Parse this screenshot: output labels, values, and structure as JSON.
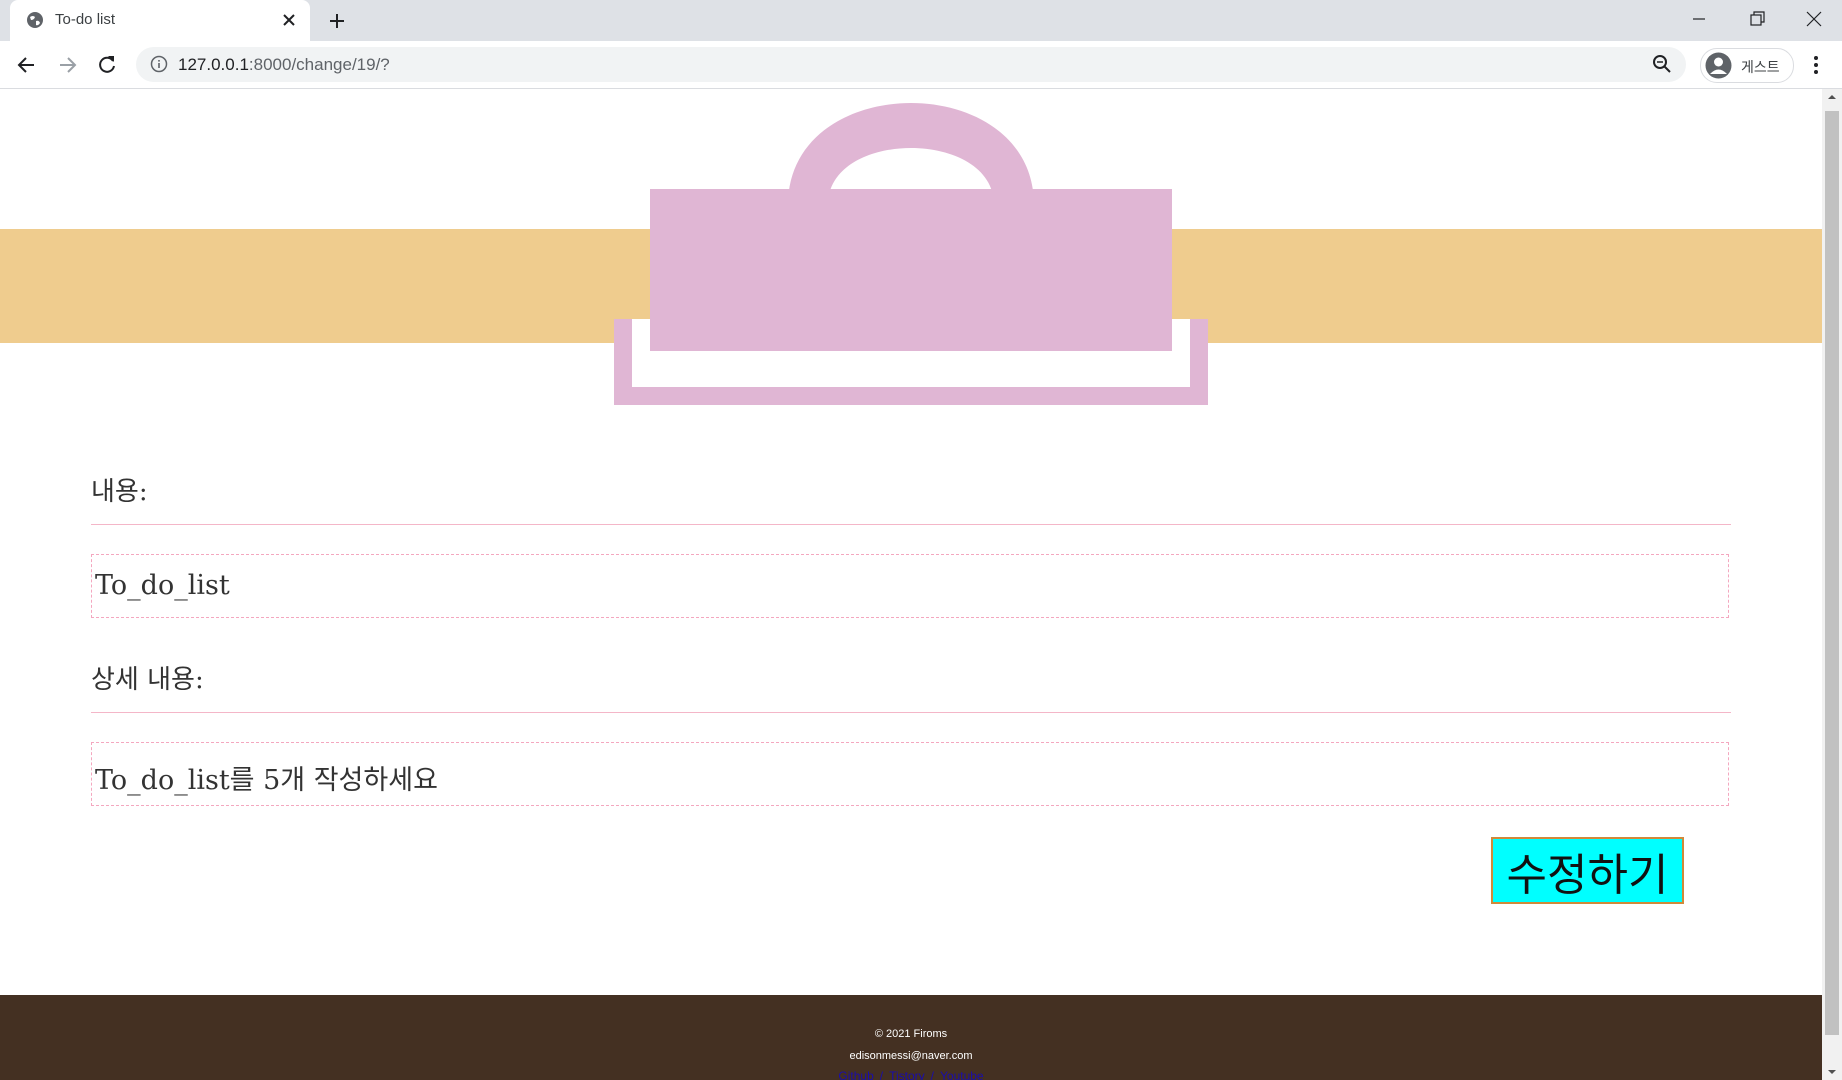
{
  "browser": {
    "tab_title": "To-do list",
    "url_host": "127.0.0.1",
    "url_rest": ":8000/change/19/?",
    "profile_label": "게스트"
  },
  "page": {
    "content_label": "내용:",
    "content_value": "To_do_list",
    "detail_label": "상세 내용:",
    "detail_value": "To_do_list를 5개 작성하세요",
    "submit_label": "수정하기"
  },
  "footer": {
    "copyright": "© 2021 Firoms",
    "email": "edisonmessi@naver.com",
    "links": [
      "Github",
      "Tistory",
      "Youtube"
    ]
  },
  "colors": {
    "banner": "#efcc8e",
    "clipboard": "#e0b6d4",
    "footer": "#443022",
    "button": "#00ffff",
    "accent_line": "#f4b6c8"
  },
  "icons": [
    "globe-icon",
    "close-icon",
    "plus-icon",
    "back-icon",
    "forward-icon",
    "reload-icon",
    "info-icon",
    "zoom-icon",
    "avatar-icon",
    "kebab-menu-icon",
    "clipboard-icon"
  ]
}
